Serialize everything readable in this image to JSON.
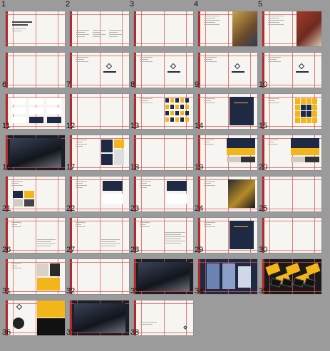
{
  "slides": [
    {
      "n": "1",
      "label": "BRAND GUIDELINES",
      "type": "title"
    },
    {
      "n": "2",
      "label": "CONTENTS",
      "type": "contents"
    },
    {
      "n": "3",
      "label": "01 INTRODUCTION",
      "type": "section"
    },
    {
      "n": "4",
      "label": "",
      "type": "photo-text"
    },
    {
      "n": "5",
      "label": "",
      "type": "photo-text"
    },
    {
      "n": "6",
      "label": "02 LOGOS",
      "type": "section"
    },
    {
      "n": "7",
      "label": "",
      "type": "logo"
    },
    {
      "n": "8",
      "label": "",
      "type": "logo"
    },
    {
      "n": "9",
      "label": "",
      "type": "logo"
    },
    {
      "n": "10",
      "label": "",
      "type": "logo"
    },
    {
      "n": "11",
      "label": "",
      "type": "logo-grid"
    },
    {
      "n": "12",
      "label": "03 ASSETS",
      "type": "section"
    },
    {
      "n": "13",
      "label": "",
      "type": "pattern"
    },
    {
      "n": "14",
      "label": "",
      "type": "navy-card"
    },
    {
      "n": "15",
      "label": "",
      "type": "yellow-grid"
    },
    {
      "n": "16",
      "label": "",
      "type": "dark-photo"
    },
    {
      "n": "17",
      "label": "",
      "type": "assets"
    },
    {
      "n": "18",
      "label": "04 COLORS",
      "type": "section"
    },
    {
      "n": "19",
      "label": "",
      "type": "palette"
    },
    {
      "n": "20",
      "label": "",
      "type": "palette"
    },
    {
      "n": "21",
      "label": "",
      "type": "swatches"
    },
    {
      "n": "22",
      "label": "",
      "type": "mockup"
    },
    {
      "n": "23",
      "label": "",
      "type": "mockup"
    },
    {
      "n": "24",
      "label": "",
      "type": "mockup-photo"
    },
    {
      "n": "25",
      "label": "05 TYPOGRAPHY",
      "type": "section"
    },
    {
      "n": "26",
      "label": "",
      "type": "type-aa"
    },
    {
      "n": "27",
      "label": "",
      "type": "type-aa"
    },
    {
      "n": "28",
      "label": "",
      "type": "type-scale"
    },
    {
      "n": "29",
      "label": "",
      "type": "navy-card"
    },
    {
      "n": "30",
      "label": "06 PHOTOGRAPHY",
      "type": "section"
    },
    {
      "n": "31",
      "label": "",
      "type": "photos"
    },
    {
      "n": "32",
      "label": "07 BRAND IN ACTION",
      "type": "section"
    },
    {
      "n": "33",
      "label": "",
      "type": "dark-photo"
    },
    {
      "n": "34",
      "label": "",
      "type": "blue-photo"
    },
    {
      "n": "35",
      "label": "",
      "type": "yellow-cards"
    },
    {
      "n": "36",
      "label": "",
      "type": "merch"
    },
    {
      "n": "37",
      "label": "",
      "type": "dark-photo"
    },
    {
      "n": "38",
      "label": "",
      "type": "end"
    }
  ],
  "text": {
    "title_sub": "The Brand Book",
    "contents_list": "01 Introduction 02 Logos 03 Assets 04 Colors 05 Typography 06 Photography 07 Brand in Action",
    "type_aa": "Aa",
    "type_aa_small": "AA",
    "colors_label": "COLORS"
  },
  "colors": {
    "accent": "#b22a2a",
    "navy": "#1e2a44",
    "yellow": "#f2b51a",
    "paper": "#f7f5f1",
    "backdrop": "#9b9b9b"
  }
}
